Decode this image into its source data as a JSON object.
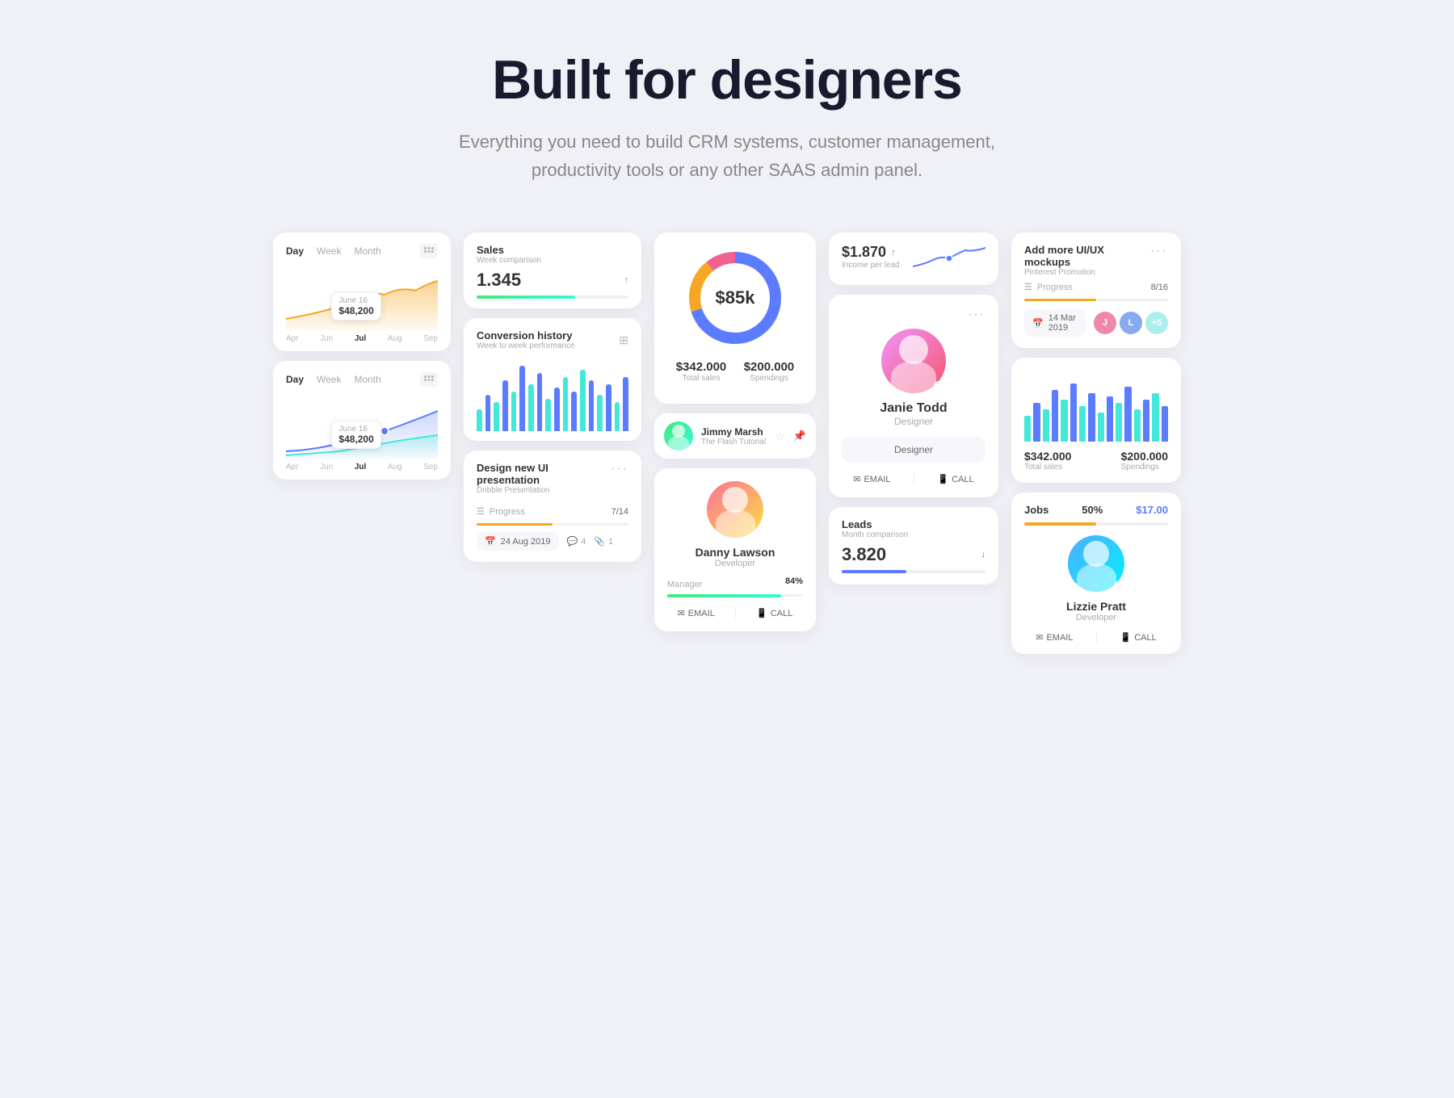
{
  "hero": {
    "title": "Built for designers",
    "subtitle": "Everything you need to build CRM systems, customer management, productivity tools or any other SAAS admin panel."
  },
  "col1": {
    "card1": {
      "tabs": [
        "Day",
        "Week",
        "Month"
      ],
      "active_tab": "Week",
      "tooltip_date": "June 16",
      "tooltip_val": "$48,200",
      "labels": [
        "Apr",
        "Jun",
        "Jul",
        "Aug",
        "Sep"
      ]
    },
    "card2": {
      "tabs": [
        "Day",
        "Week",
        "Month"
      ],
      "active_tab": "Week",
      "tooltip_date": "June 16",
      "tooltip_val": "$48,200",
      "labels": [
        "Apr",
        "Jun",
        "Jul",
        "Aug",
        "Sep"
      ]
    }
  },
  "col2": {
    "sales": {
      "label": "Sales",
      "sub": "Week comparison",
      "value": "1.345",
      "badge": "↑"
    },
    "conversion": {
      "title": "Conversion history",
      "sub": "Week to week performance"
    },
    "project": {
      "title": "Design new UI presentation",
      "sub": "Dribble Presentation",
      "progress_label": "Progress",
      "progress_val": "7/14",
      "date": "24 Aug 2019",
      "comments": "4",
      "attachments": "1"
    }
  },
  "col3": {
    "donut": {
      "center_val": "$85k",
      "stat1_val": "$342.000",
      "stat1_label": "Total sales",
      "stat2_val": "$200.000",
      "stat2_label": "Spendings"
    },
    "user": {
      "name": "Jimmy Marsh",
      "role": "The Flash Tutorial"
    },
    "person": {
      "name": "Danny Lawson",
      "role": "Developer",
      "skill_label": "Manager",
      "skill_pct": "84%",
      "email_label": "EMAIL",
      "call_label": "CALL"
    }
  },
  "col4": {
    "income": {
      "val": "$1.870",
      "badge": "↑",
      "sub": "Income per lead"
    },
    "profile": {
      "name": "Janie Todd",
      "role": "Designer",
      "role_btn": "Designer",
      "email_label": "EMAIL",
      "call_label": "CALL"
    },
    "leads": {
      "label": "Leads",
      "sub": "Month comparison",
      "value": "3.820",
      "badge": "↓"
    }
  },
  "col5": {
    "project": {
      "title": "Add more UI/UX mockups",
      "sub": "Pinterest Promotion",
      "progress_label": "Progress",
      "progress_val": "8/16",
      "date": "14 Mar 2019"
    },
    "chart": {
      "stat1_val": "$342.000",
      "stat1_label": "Total sales",
      "stat2_val": "$200.000",
      "stat2_label": "Spendings"
    },
    "jobs": {
      "title": "Jobs",
      "pct": "50%",
      "price": "$17.00"
    },
    "person": {
      "name": "Lizzie Pratt",
      "role": "Developer",
      "email_label": "EMAIL",
      "call_label": "CALL"
    }
  }
}
